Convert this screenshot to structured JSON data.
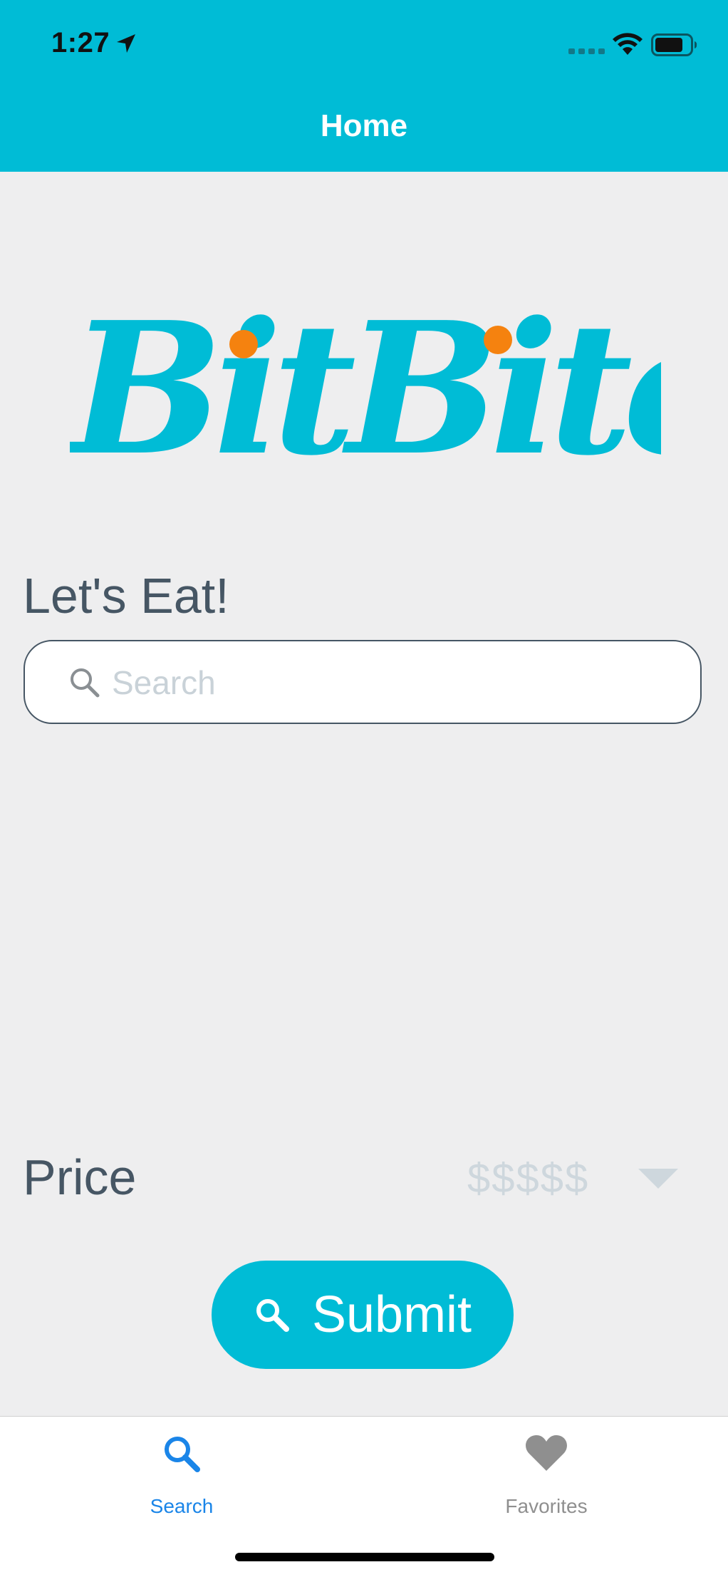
{
  "status_bar": {
    "time": "1:27"
  },
  "header": {
    "title": "Home"
  },
  "logo": {
    "text": "BitBite",
    "primary_color": "#00bcd6",
    "accent_color": "#f5820f"
  },
  "main": {
    "heading": "Let's Eat!",
    "search": {
      "placeholder": "Search",
      "value": ""
    },
    "price": {
      "label": "Price",
      "selected": "$$$$$"
    },
    "submit_label": "Submit"
  },
  "tabbar": {
    "tabs": [
      {
        "label": "Search",
        "icon": "search-icon",
        "active": true
      },
      {
        "label": "Favorites",
        "icon": "heart-icon",
        "active": false
      }
    ]
  },
  "colors": {
    "header": "#00bcd6",
    "background": "#eeeeef",
    "text": "#465664",
    "active_tab": "#1a85e8",
    "inactive_tab": "#8f8f8f"
  }
}
